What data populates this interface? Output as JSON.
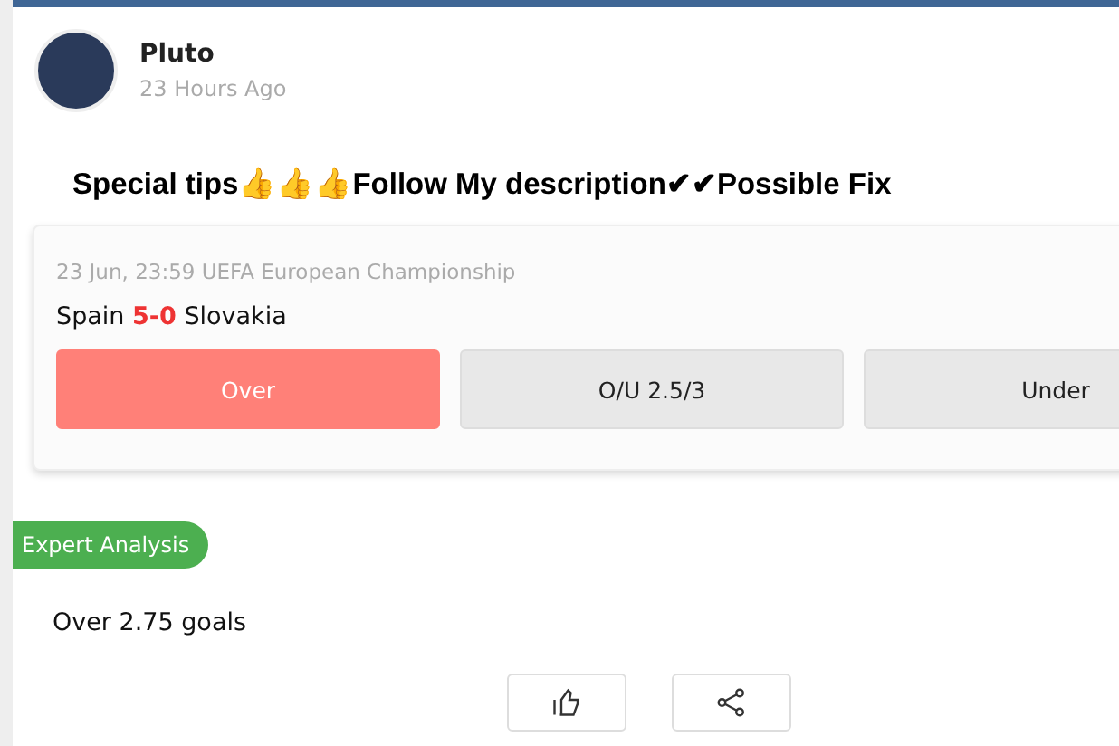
{
  "post": {
    "author": "Pluto",
    "time": "23 Hours Ago",
    "title": "Special tips👍👍👍Follow My description✔✔Possible Fix"
  },
  "match": {
    "info": "23 Jun, 23:59 UEFA European Championship",
    "home": "Spain",
    "score": "5-0",
    "away": "Slovakia",
    "options": [
      {
        "label": "Over",
        "selected": true
      },
      {
        "label": "O/U 2.5/3",
        "selected": false
      },
      {
        "label": "Under",
        "selected": false
      }
    ]
  },
  "analysis": {
    "badge": "Expert Analysis",
    "text": "Over 2.75 goals"
  }
}
